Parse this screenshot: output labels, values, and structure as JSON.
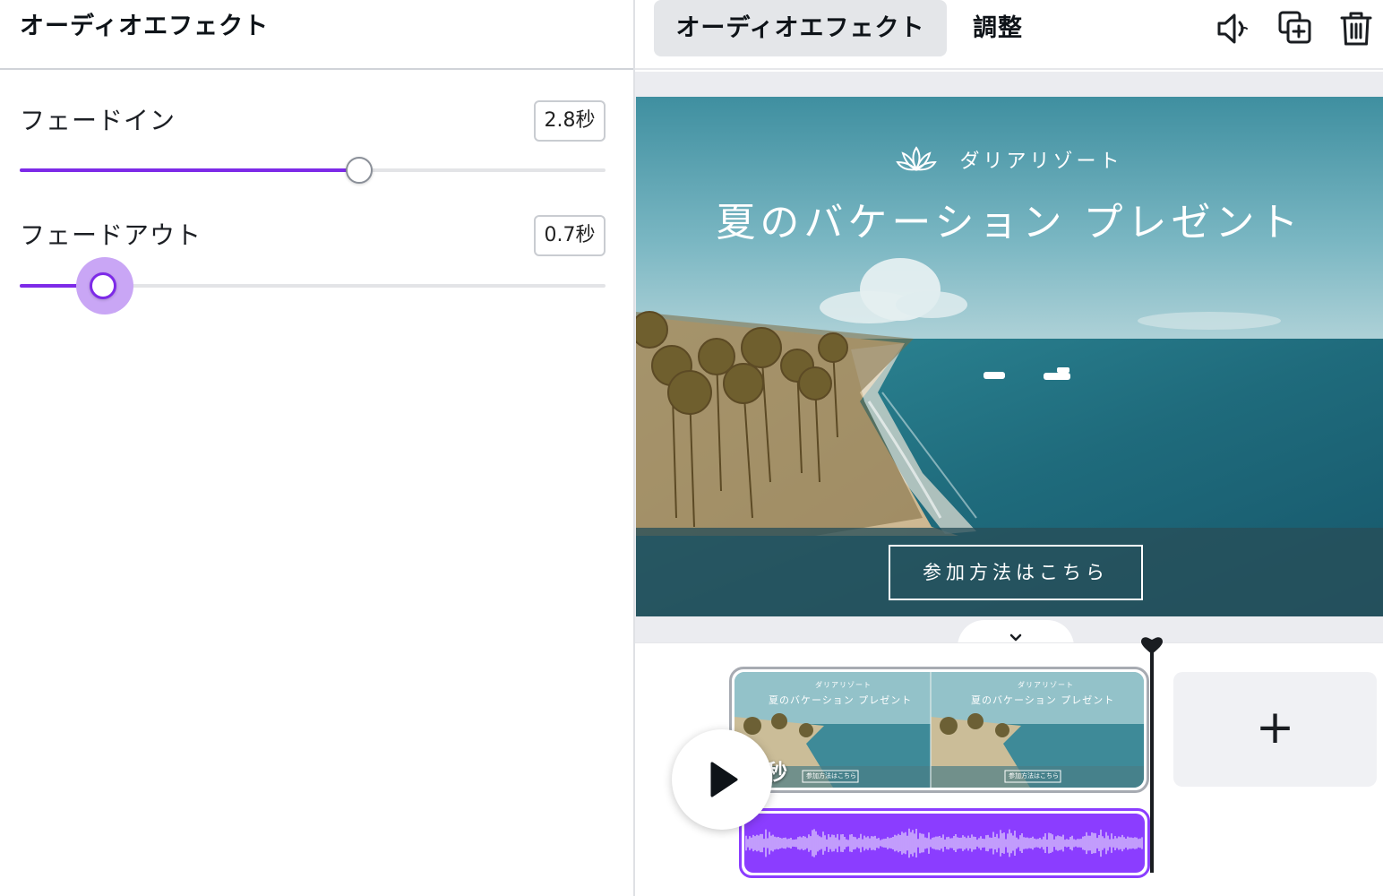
{
  "left_panel": {
    "title": "オーディオエフェクト",
    "fade_in": {
      "label": "フェードイン",
      "value_text": "2.8秒",
      "level": 0.58
    },
    "fade_out": {
      "label": "フェードアウト",
      "value_text": "0.7秒",
      "level": 0.145
    }
  },
  "toolbar": {
    "tab_audio_effects": "オーディオエフェクト",
    "tab_adjust": "調整",
    "icons": [
      "speaker-icon",
      "duplicate-icon",
      "trash-icon"
    ]
  },
  "design": {
    "brand_name": "ダリアリゾート",
    "headline": "夏のバケーション プレゼント",
    "cta_label": "参加方法はこちら"
  },
  "timeline": {
    "thumb_brand": "ダリアリゾート",
    "thumb_headline": "夏のバケーション プレゼント",
    "thumb_cta": "参加方法はこちら",
    "duration_label": "秒",
    "add_label": "+"
  },
  "colors": {
    "accent": "#7d2ae8",
    "audio_clip": "#8b3dff"
  }
}
